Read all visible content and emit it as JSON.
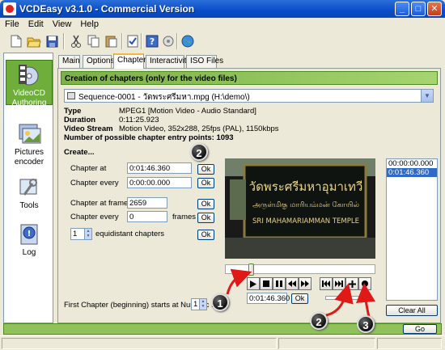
{
  "window": {
    "title": "VCDEasy v3.1.0 - Commercial Version",
    "minimize": "_",
    "maximize": "□",
    "close": "✕"
  },
  "menu": [
    "File",
    "Edit",
    "View",
    "Help"
  ],
  "toolbar_icons": [
    "new-file-icon",
    "open-folder-icon",
    "save-icon",
    "cut-icon",
    "copy-icon",
    "paste-icon",
    "check-icon",
    "help-icon",
    "about-icon",
    "web-icon"
  ],
  "sidebar": {
    "items": [
      {
        "label_line1": "VideoCD",
        "label_line2": "Authoring",
        "icon": "film-disc-icon",
        "active": true
      },
      {
        "label_line1": "Pictures",
        "label_line2": "encoder",
        "icon": "pictures-icon",
        "active": false
      },
      {
        "label_line1": "Tools",
        "label_line2": "",
        "icon": "tools-icon",
        "active": false
      },
      {
        "label_line1": "Log",
        "label_line2": "",
        "icon": "log-icon",
        "active": false
      }
    ]
  },
  "tabs": [
    "Main",
    "Options",
    "Chapters",
    "Interactivity",
    "ISO Files"
  ],
  "active_tab": "Chapters",
  "header": "Creation of chapters (only for the video files)",
  "sequence_select": "Sequence-0001 - วัดพระศรีมหา.mpg  (H:\\demo\\)",
  "info": {
    "type_label": "Type",
    "type_value": "MPEG1  [Motion Video - Audio Standard]",
    "duration_label": "Duration",
    "duration_value": "0:11:25.923",
    "stream_label": "Video Stream",
    "stream_value": "Motion Video, 352x288, 25fps (PAL), 1150kbps",
    "entry_points_label": "Number of possible chapter entry points: 1093"
  },
  "create_label": "Create...",
  "form": {
    "chapter_at_label": "Chapter at",
    "chapter_at_value": "0:01:46.360",
    "chapter_every_label": "Chapter every",
    "chapter_every_value": "0:00:00.000",
    "chapter_at_frame_label": "Chapter at frame",
    "chapter_at_frame_value": "2659",
    "chapter_every_frames_label": "Chapter every",
    "chapter_every_frames_value": "0",
    "frames_unit": "frames",
    "equidistant_value": "1",
    "equidistant_label": "equidistant chapters",
    "ok": "Ok"
  },
  "video": {
    "sign_thai": "วัดพระศรีมหาอุมาเทวี",
    "sign_tamil": "அருள்மிகு மாரியம்மன் கோயில்",
    "sign_english": "SRI MAHAMARIAMMAN TEMPLE",
    "position_fraction": 0.155
  },
  "player": {
    "time_value": "0:01:46.360",
    "ok": "Ok"
  },
  "chapter_list": [
    "00:00:00.000",
    "0:01:46.360"
  ],
  "clear_all": "Clear All",
  "first_chapter_label": "First Chapter (beginning) starts at Numeric Key",
  "first_chapter_value": "1",
  "go": "Go",
  "callouts": [
    "1",
    "2",
    "2",
    "3"
  ],
  "colors": {
    "accent_green": "#8FC25B",
    "title_blue": "#0A4CC8",
    "arrow_red": "#E01818",
    "selection": "#316AC5"
  }
}
